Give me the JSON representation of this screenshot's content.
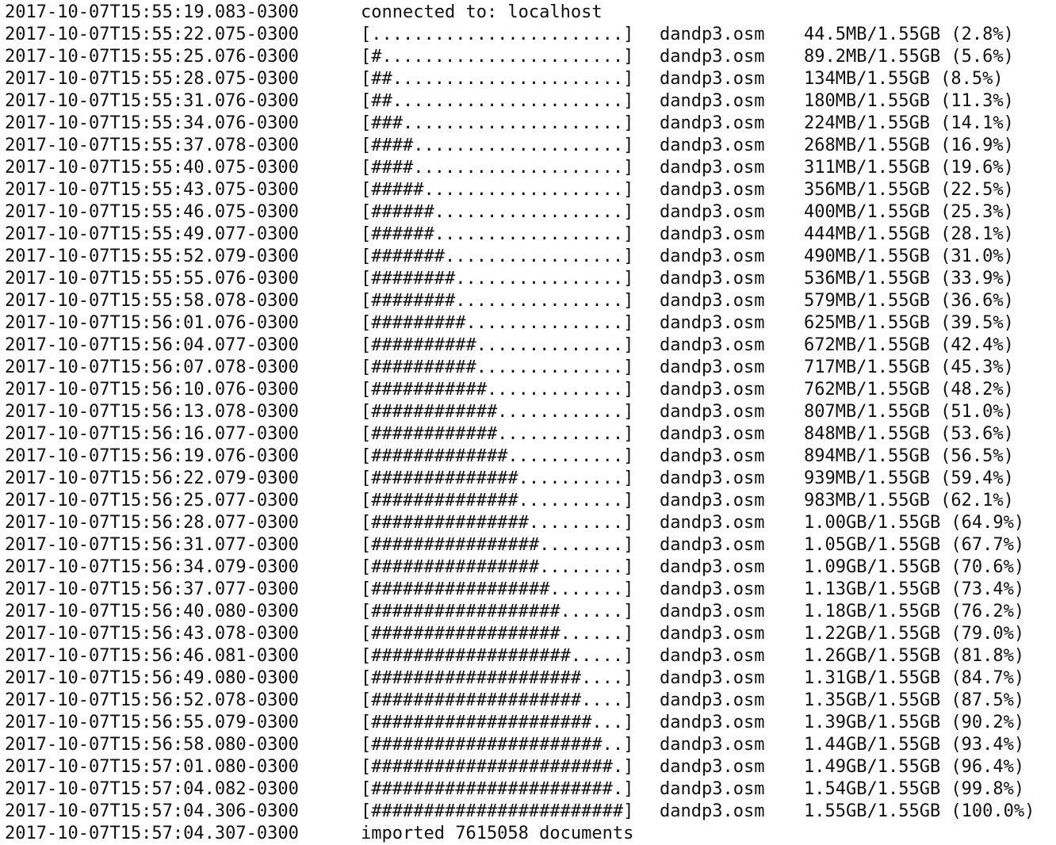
{
  "terminal": {
    "header": {
      "timestamp": "2017-10-07T15:55:19.083-0300",
      "message": "connected to: localhost"
    },
    "rows": [
      {
        "timestamp": "2017-10-07T15:55:22.075-0300",
        "bar": "[........................]",
        "file": "dandp3.osm",
        "progress": "44.5MB/1.55GB (2.8%)"
      },
      {
        "timestamp": "2017-10-07T15:55:25.076-0300",
        "bar": "[#.......................]",
        "file": "dandp3.osm",
        "progress": "89.2MB/1.55GB (5.6%)"
      },
      {
        "timestamp": "2017-10-07T15:55:28.075-0300",
        "bar": "[##......................]",
        "file": "dandp3.osm",
        "progress": "134MB/1.55GB (8.5%)"
      },
      {
        "timestamp": "2017-10-07T15:55:31.076-0300",
        "bar": "[##......................]",
        "file": "dandp3.osm",
        "progress": "180MB/1.55GB (11.3%)"
      },
      {
        "timestamp": "2017-10-07T15:55:34.076-0300",
        "bar": "[###.....................]",
        "file": "dandp3.osm",
        "progress": "224MB/1.55GB (14.1%)"
      },
      {
        "timestamp": "2017-10-07T15:55:37.078-0300",
        "bar": "[####....................]",
        "file": "dandp3.osm",
        "progress": "268MB/1.55GB (16.9%)"
      },
      {
        "timestamp": "2017-10-07T15:55:40.075-0300",
        "bar": "[####....................]",
        "file": "dandp3.osm",
        "progress": "311MB/1.55GB (19.6%)"
      },
      {
        "timestamp": "2017-10-07T15:55:43.075-0300",
        "bar": "[#####...................]",
        "file": "dandp3.osm",
        "progress": "356MB/1.55GB (22.5%)"
      },
      {
        "timestamp": "2017-10-07T15:55:46.075-0300",
        "bar": "[######..................]",
        "file": "dandp3.osm",
        "progress": "400MB/1.55GB (25.3%)"
      },
      {
        "timestamp": "2017-10-07T15:55:49.077-0300",
        "bar": "[######..................]",
        "file": "dandp3.osm",
        "progress": "444MB/1.55GB (28.1%)"
      },
      {
        "timestamp": "2017-10-07T15:55:52.079-0300",
        "bar": "[#######.................]",
        "file": "dandp3.osm",
        "progress": "490MB/1.55GB (31.0%)"
      },
      {
        "timestamp": "2017-10-07T15:55:55.076-0300",
        "bar": "[########................]",
        "file": "dandp3.osm",
        "progress": "536MB/1.55GB (33.9%)"
      },
      {
        "timestamp": "2017-10-07T15:55:58.078-0300",
        "bar": "[########................]",
        "file": "dandp3.osm",
        "progress": "579MB/1.55GB (36.6%)"
      },
      {
        "timestamp": "2017-10-07T15:56:01.076-0300",
        "bar": "[#########...............]",
        "file": "dandp3.osm",
        "progress": "625MB/1.55GB (39.5%)"
      },
      {
        "timestamp": "2017-10-07T15:56:04.077-0300",
        "bar": "[##########..............]",
        "file": "dandp3.osm",
        "progress": "672MB/1.55GB (42.4%)"
      },
      {
        "timestamp": "2017-10-07T15:56:07.078-0300",
        "bar": "[##########..............]",
        "file": "dandp3.osm",
        "progress": "717MB/1.55GB (45.3%)"
      },
      {
        "timestamp": "2017-10-07T15:56:10.076-0300",
        "bar": "[###########.............]",
        "file": "dandp3.osm",
        "progress": "762MB/1.55GB (48.2%)"
      },
      {
        "timestamp": "2017-10-07T15:56:13.078-0300",
        "bar": "[############............]",
        "file": "dandp3.osm",
        "progress": "807MB/1.55GB (51.0%)"
      },
      {
        "timestamp": "2017-10-07T15:56:16.077-0300",
        "bar": "[############............]",
        "file": "dandp3.osm",
        "progress": "848MB/1.55GB (53.6%)"
      },
      {
        "timestamp": "2017-10-07T15:56:19.076-0300",
        "bar": "[#############...........]",
        "file": "dandp3.osm",
        "progress": "894MB/1.55GB (56.5%)"
      },
      {
        "timestamp": "2017-10-07T15:56:22.079-0300",
        "bar": "[##############..........]",
        "file": "dandp3.osm",
        "progress": "939MB/1.55GB (59.4%)"
      },
      {
        "timestamp": "2017-10-07T15:56:25.077-0300",
        "bar": "[##############..........]",
        "file": "dandp3.osm",
        "progress": "983MB/1.55GB (62.1%)"
      },
      {
        "timestamp": "2017-10-07T15:56:28.077-0300",
        "bar": "[###############.........]",
        "file": "dandp3.osm",
        "progress": "1.00GB/1.55GB (64.9%)"
      },
      {
        "timestamp": "2017-10-07T15:56:31.077-0300",
        "bar": "[################........]",
        "file": "dandp3.osm",
        "progress": "1.05GB/1.55GB (67.7%)"
      },
      {
        "timestamp": "2017-10-07T15:56:34.079-0300",
        "bar": "[################........]",
        "file": "dandp3.osm",
        "progress": "1.09GB/1.55GB (70.6%)"
      },
      {
        "timestamp": "2017-10-07T15:56:37.077-0300",
        "bar": "[#################.......]",
        "file": "dandp3.osm",
        "progress": "1.13GB/1.55GB (73.4%)"
      },
      {
        "timestamp": "2017-10-07T15:56:40.080-0300",
        "bar": "[##################......]",
        "file": "dandp3.osm",
        "progress": "1.18GB/1.55GB (76.2%)"
      },
      {
        "timestamp": "2017-10-07T15:56:43.078-0300",
        "bar": "[##################......]",
        "file": "dandp3.osm",
        "progress": "1.22GB/1.55GB (79.0%)"
      },
      {
        "timestamp": "2017-10-07T15:56:46.081-0300",
        "bar": "[###################.....]",
        "file": "dandp3.osm",
        "progress": "1.26GB/1.55GB (81.8%)"
      },
      {
        "timestamp": "2017-10-07T15:56:49.080-0300",
        "bar": "[####################....]",
        "file": "dandp3.osm",
        "progress": "1.31GB/1.55GB (84.7%)"
      },
      {
        "timestamp": "2017-10-07T15:56:52.078-0300",
        "bar": "[####################....]",
        "file": "dandp3.osm",
        "progress": "1.35GB/1.55GB (87.5%)"
      },
      {
        "timestamp": "2017-10-07T15:56:55.079-0300",
        "bar": "[#####################...]",
        "file": "dandp3.osm",
        "progress": "1.39GB/1.55GB (90.2%)"
      },
      {
        "timestamp": "2017-10-07T15:56:58.080-0300",
        "bar": "[######################..]",
        "file": "dandp3.osm",
        "progress": "1.44GB/1.55GB (93.4%)"
      },
      {
        "timestamp": "2017-10-07T15:57:01.080-0300",
        "bar": "[#######################.]",
        "file": "dandp3.osm",
        "progress": "1.49GB/1.55GB (96.4%)"
      },
      {
        "timestamp": "2017-10-07T15:57:04.082-0300",
        "bar": "[#######################.]",
        "file": "dandp3.osm",
        "progress": "1.54GB/1.55GB (99.8%)"
      },
      {
        "timestamp": "2017-10-07T15:57:04.306-0300",
        "bar": "[########################]",
        "file": "dandp3.osm",
        "progress": "1.55GB/1.55GB (100.0%)"
      }
    ],
    "footer": {
      "timestamp": "2017-10-07T15:57:04.307-0300",
      "message": "imported 7615058 documents"
    }
  }
}
